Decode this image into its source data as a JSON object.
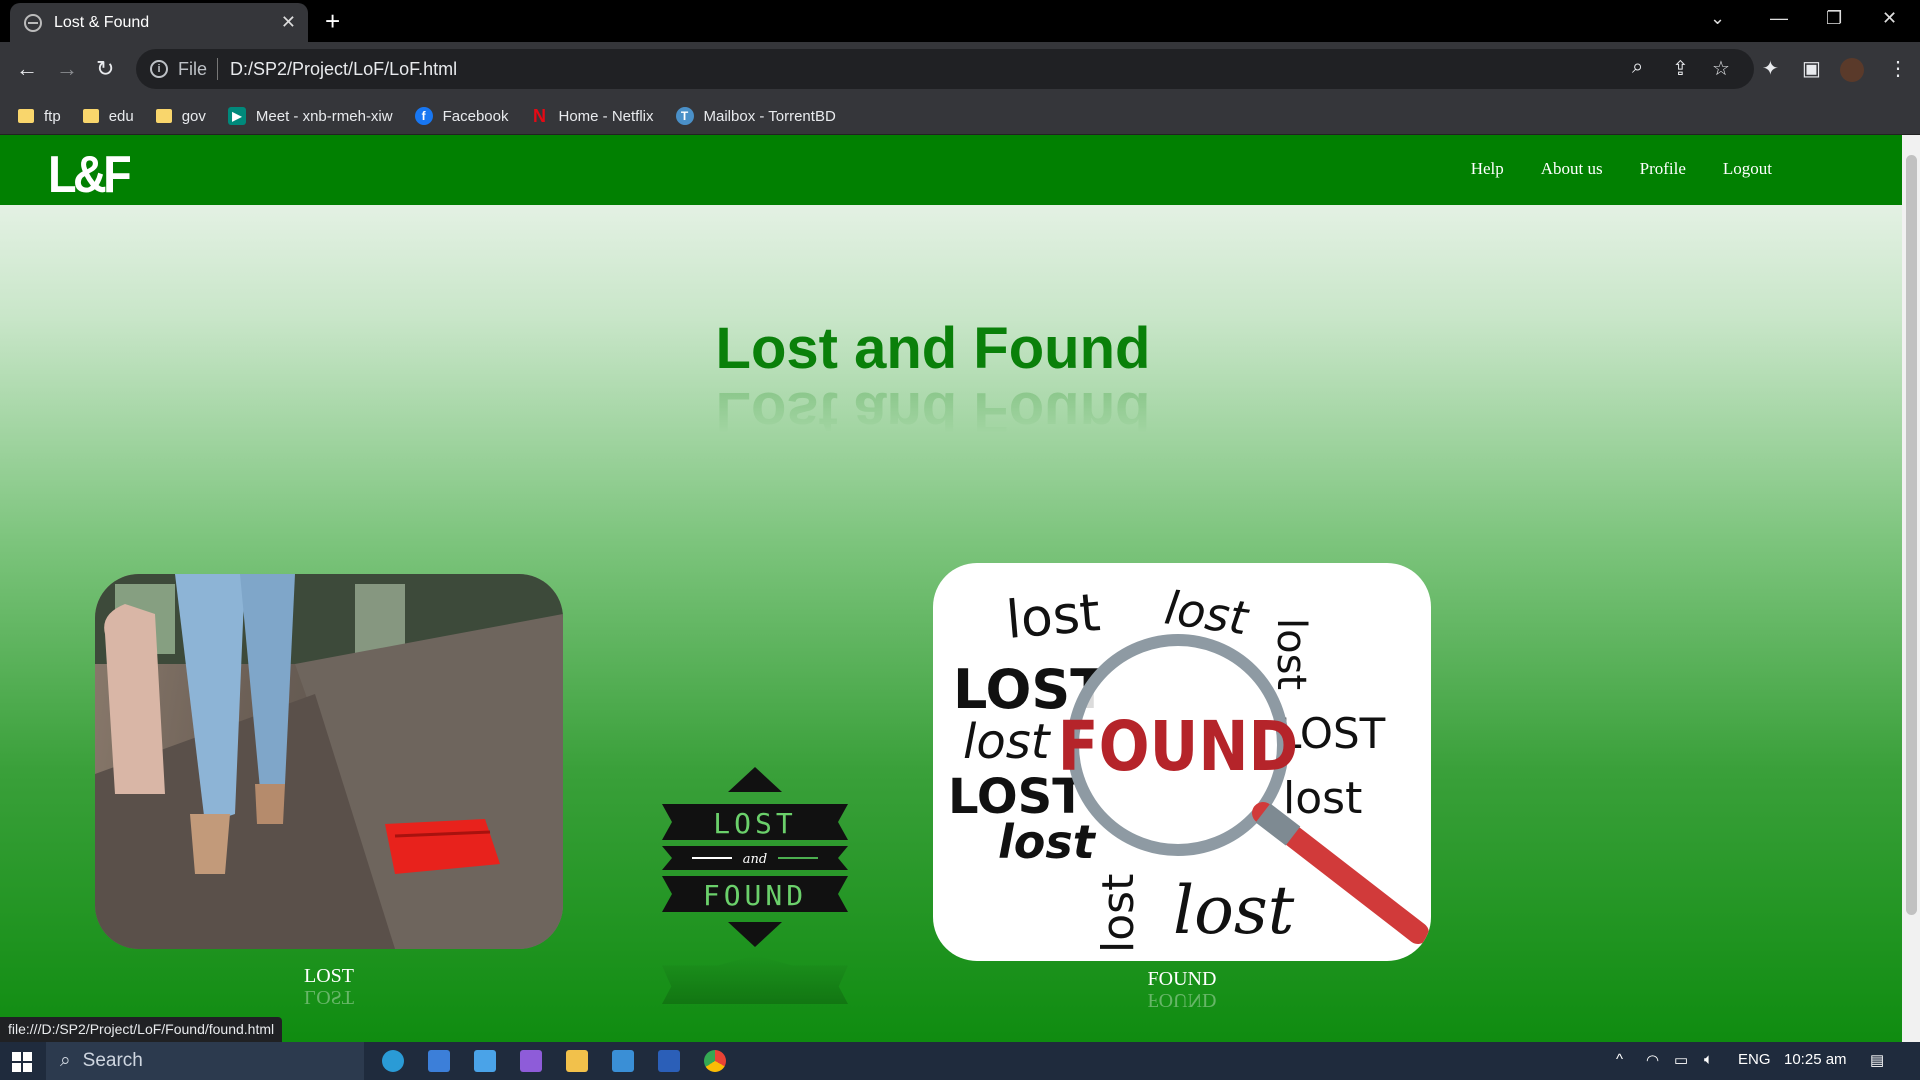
{
  "browser": {
    "tab_title": "Lost & Found",
    "address_scheme": "File",
    "address_url": "D:/SP2/Project/LoF/LoF.html",
    "status_url": "file:///D:/SP2/Project/LoF/Found/found.html"
  },
  "bookmarks": [
    {
      "label": "ftp",
      "icon": "folder-icon"
    },
    {
      "label": "edu",
      "icon": "folder-icon"
    },
    {
      "label": "gov",
      "icon": "folder-icon"
    },
    {
      "label": "Meet - xnb-rmeh-xiw",
      "icon": "meet-icon"
    },
    {
      "label": "Facebook",
      "icon": "facebook-icon"
    },
    {
      "label": "Home - Netflix",
      "icon": "netflix-icon"
    },
    {
      "label": "Mailbox - TorrentBD",
      "icon": "torrentbd-icon"
    }
  ],
  "site": {
    "logo": "L&F",
    "nav": [
      "Help",
      "About us",
      "Profile",
      "Logout"
    ],
    "heading": "Lost and Found",
    "lost_label": "LOST",
    "found_label": "FOUND",
    "center_badge": {
      "top": "LOST",
      "middle": "and",
      "bottom": "FOUND"
    },
    "brand_color": "#018001"
  },
  "taskbar": {
    "search_placeholder": "Search",
    "language": "ENG",
    "time": "10:25 am"
  }
}
